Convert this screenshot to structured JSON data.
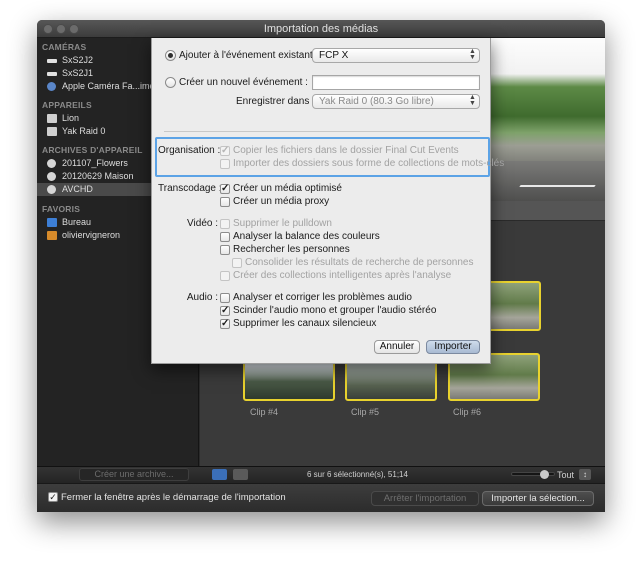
{
  "window": {
    "title": "Importation des médias"
  },
  "sidebar": {
    "sections": [
      {
        "header": "CAMÉRAS",
        "items": [
          {
            "label": "SxS2J2",
            "icon": "camera-icon"
          },
          {
            "label": "SxS2J1",
            "icon": "camera-icon"
          },
          {
            "label": "Apple Caméra Fa...ime H",
            "icon": "facetime-camera-icon"
          }
        ]
      },
      {
        "header": "APPAREILS",
        "items": [
          {
            "label": "Lion",
            "icon": "disk-icon"
          },
          {
            "label": "Yak Raid 0",
            "icon": "disk-icon"
          }
        ]
      },
      {
        "header": "ARCHIVES D'APPAREIL",
        "items": [
          {
            "label": "201107_Flowers",
            "icon": "archive-icon"
          },
          {
            "label": "20120629 Maison",
            "icon": "archive-icon"
          },
          {
            "label": "AVCHD",
            "icon": "archive-icon",
            "selected": true
          }
        ]
      },
      {
        "header": "FAVORIS",
        "items": [
          {
            "label": "Bureau",
            "icon": "folder-icon"
          },
          {
            "label": "oliviervigneron",
            "icon": "home-icon"
          }
        ]
      }
    ],
    "create_archive_button": "Créer une archive..."
  },
  "browser": {
    "clips": [
      {
        "label": "Clip #4"
      },
      {
        "label": "Clip #5"
      },
      {
        "label": "Clip #6"
      }
    ],
    "status": "6 sur 6 sélectionné(s), 51;14",
    "zoom_label": "Tout"
  },
  "footer": {
    "close_checkbox_label": "Fermer la fenêtre après le démarrage de l'importation",
    "close_checked": true,
    "stop_button": "Arrêter l'importation",
    "import_selection_button": "Importer la sélection..."
  },
  "sheet": {
    "add_existing_label": "Ajouter à l'événement existant :",
    "existing_event_value": "FCP X",
    "create_new_label": "Créer un nouvel événement :",
    "new_event_value": "",
    "save_in_label": "Enregistrer dans :",
    "save_in_value": "Yak Raid 0   (80.3  Go libre)",
    "organisation": {
      "label": "Organisation :",
      "copy_files": "Copier les fichiers dans le dossier Final Cut Events",
      "import_folders": "Importer des dossiers sous forme de collections de mots-clés"
    },
    "transcodage": {
      "label": "Transcodage :",
      "optimized": "Créer un média optimisé",
      "proxy": "Créer un média proxy"
    },
    "video": {
      "label": "Vidéo :",
      "pulldown": "Supprimer le pulldown",
      "color_balance": "Analyser la balance des couleurs",
      "find_people": "Rechercher les personnes",
      "consolidate": "Consolider les résultats de recherche de personnes",
      "smart_collections": "Créer des collections intelligentes après l'analyse"
    },
    "audio": {
      "label": "Audio :",
      "analyze_fix": "Analyser et corriger les problèmes audio",
      "separate_mono": "Scinder l'audio mono et grouper l'audio stéréo",
      "remove_silent": "Supprimer les canaux silencieux"
    },
    "cancel_button": "Annuler",
    "import_button": "Importer"
  },
  "colors": {
    "highlight_box": "#5ca3e6",
    "clip_selection": "#e8d22e"
  }
}
